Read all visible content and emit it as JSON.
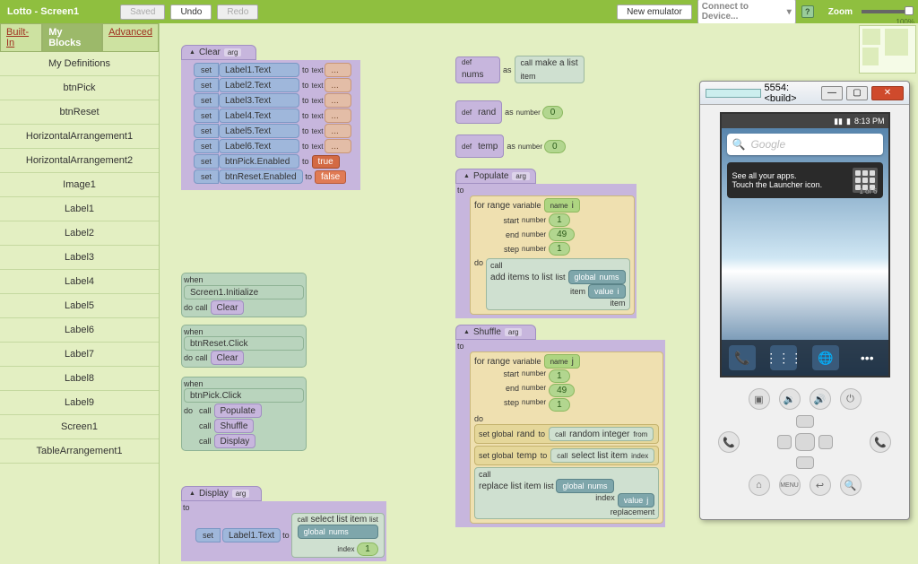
{
  "header": {
    "title": "Lotto - Screen1",
    "saved": "Saved",
    "undo": "Undo",
    "redo": "Redo",
    "new_emulator": "New emulator",
    "connect": "Connect to Device...",
    "zoom_label": "Zoom",
    "zoom_value": "100%"
  },
  "tabs": {
    "builtin": "Built-In",
    "myblocks": "My Blocks",
    "advanced": "Advanced"
  },
  "sidebar_items": [
    "My Definitions",
    "btnPick",
    "btnReset",
    "HorizontalArrangement1",
    "HorizontalArrangement2",
    "Image1",
    "Label1",
    "Label2",
    "Label3",
    "Label4",
    "Label5",
    "Label6",
    "Label7",
    "Label8",
    "Label9",
    "Screen1",
    "TableArrangement1"
  ],
  "blocks": {
    "to": "to",
    "set": "set",
    "do": "do",
    "when": "when",
    "call": "call",
    "arg": "arg",
    "as": "as",
    "text": "text",
    "def": "def",
    "number": "number",
    "name": "name",
    "value": "value",
    "global": "global",
    "variable": "variable",
    "start": "start",
    "end": "end",
    "step": "step",
    "list": "list",
    "item": "item",
    "index": "index",
    "replacement": "replacement",
    "from": "from",
    "set_global": "set global",
    "true": "true",
    "false": "false",
    "dots": "..."
  },
  "clear": {
    "name": "Clear",
    "sets": [
      "Label1.Text",
      "Label2.Text",
      "Label3.Text",
      "Label4.Text",
      "Label5.Text",
      "Label6.Text",
      "btnPick.Enabled",
      "btnReset.Enabled"
    ]
  },
  "events": {
    "init": "Screen1.Initialize",
    "reset": "btnReset.Click",
    "pick": "btnPick.Click",
    "call_clear": "Clear",
    "call_populate": "Populate",
    "call_shuffle": "Shuffle",
    "call_display": "Display"
  },
  "defs": {
    "nums": "nums",
    "rand": "rand",
    "temp": "temp",
    "make_a_list": "make a list",
    "zero": "0"
  },
  "populate": {
    "name": "Populate",
    "for_range": "for range",
    "var_i": "i",
    "start": "1",
    "end": "49",
    "step": "1",
    "add_items": "add items to list",
    "nums": "nums"
  },
  "shuffle": {
    "name": "Shuffle",
    "for_range": "for range",
    "var_j": "j",
    "start": "1",
    "end": "49",
    "step": "1",
    "rand": "rand",
    "random_integer": "random integer",
    "temp": "temp",
    "select_item": "select list item",
    "replace_item": "replace list item",
    "nums": "nums"
  },
  "display": {
    "name": "Display",
    "label1": "Label1.Text",
    "select_item": "select list item",
    "nums": "nums",
    "one": "1"
  },
  "emulator": {
    "title": "5554:<build>",
    "time": "8:13 PM",
    "search_placeholder": "Google",
    "hint_title": "See all your apps.",
    "hint_sub": "Touch the Launcher icon.",
    "pager": "1 of 6",
    "menu": "MENU"
  }
}
